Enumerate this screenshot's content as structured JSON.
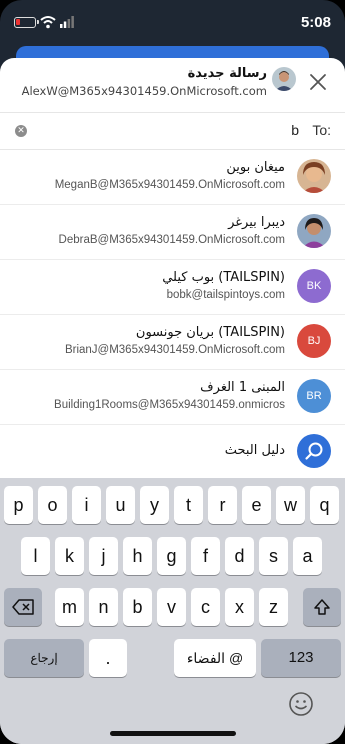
{
  "status": {
    "time": "5:08"
  },
  "compose": {
    "title": "رسالة جديدة",
    "from": "AlexW@M365x94301459.OnMicrosoft.com",
    "to_label": "To:",
    "to_value": "b"
  },
  "results": [
    {
      "name": "ميغان بوين",
      "email": "MeganB@M365x94301459.OnMicrosoft.com",
      "avatar": "photo",
      "color": "#c98a4f"
    },
    {
      "name": "ديبرا بيرغر",
      "email": "DebraB@M365x94301459.OnMicrosoft.com",
      "avatar": "photo",
      "color": "#6a4a8c"
    },
    {
      "name": "بوب كيلي (TAILSPIN)",
      "email": "bobk@tailspintoys.com",
      "avatar": "BK",
      "color": "#8d6bd0"
    },
    {
      "name": "بريان جونسون (TAILSPIN)",
      "email": "BrianJ@M365x94301459.OnMicrosoft.com",
      "avatar": "BJ",
      "color": "#d9493d"
    },
    {
      "name": "المبنى 1    الغرف",
      "email": "Building1Rooms@M365x94301459.onmicros",
      "avatar": "BR",
      "color": "#4d8fd6"
    }
  ],
  "directory_search": "دليل البحث",
  "keyboard": {
    "row1": [
      "p",
      "o",
      "i",
      "u",
      "y",
      "t",
      "r",
      "e",
      "w",
      "q"
    ],
    "row2": [
      "l",
      "k",
      "j",
      "h",
      "g",
      "f",
      "d",
      "s",
      "a"
    ],
    "row3": [
      "m",
      "n",
      "b",
      "v",
      "c",
      "x",
      "z"
    ],
    "enter": "إرجاع",
    "period": ".",
    "space": "الفضاء @",
    "numbers": "123"
  }
}
